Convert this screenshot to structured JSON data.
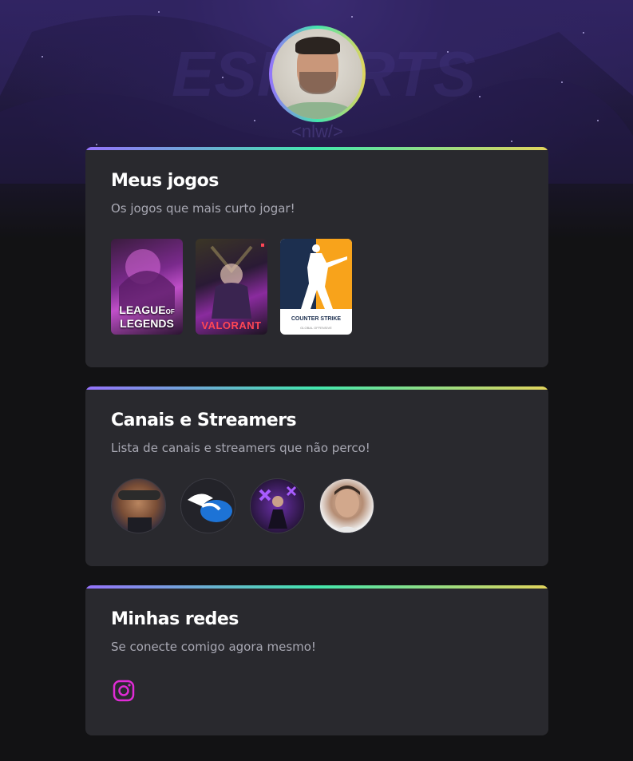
{
  "profile": {
    "avatar_alt": "Foto de perfil"
  },
  "sections": {
    "games": {
      "title": "Meus jogos",
      "subtitle": "Os jogos que mais curto jogar!",
      "items": [
        {
          "name": "League of Legends",
          "caption_l1": "LEAGUE",
          "caption_l2": "LEGENDS",
          "caption_of": "OF"
        },
        {
          "name": "Valorant",
          "caption": "VALORANT"
        },
        {
          "name": "Counter Strike",
          "caption": "COUNTER STRIKE",
          "sub": "GLOBAL OFFENSIVE"
        }
      ]
    },
    "streamers": {
      "title": "Canais e Streamers",
      "subtitle": "Lista de canais e streamers que não perco!",
      "items": [
        "streamer-1",
        "streamer-2",
        "streamer-3",
        "streamer-4"
      ]
    },
    "social": {
      "title": "Minhas redes",
      "subtitle": "Se conecte comigo agora mesmo!",
      "links": [
        {
          "icon": "instagram-icon",
          "color": "#e02bd6"
        }
      ]
    }
  },
  "colors": {
    "background": "#121214",
    "card": "#29292e",
    "gradient": [
      "#9572fc",
      "#43e7ad",
      "#e2d45c"
    ]
  }
}
